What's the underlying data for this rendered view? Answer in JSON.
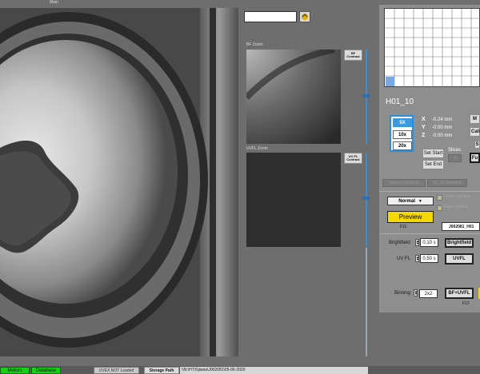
{
  "main_view": {
    "title": "Main"
  },
  "top_input": {
    "value": ""
  },
  "bf_zoom": {
    "title": "BF Zoom",
    "contrast_label": "BF Contrast"
  },
  "uvfl_zoom": {
    "title": "UVFL Zoom",
    "contrast_label": "UV FL Contrast"
  },
  "well_id": "H01_10",
  "objectives": [
    "5X",
    "10x",
    "20x"
  ],
  "selected_objective": "5X",
  "position": {
    "x_label": "X",
    "x_value": "-0.24 mm",
    "y_label": "Y",
    "y_value": "-0.00 mm",
    "z_label": "Z",
    "z_value": "-0.00 mm"
  },
  "buttons": {
    "set_start": "Set Start",
    "set_end": "Set End",
    "slices_label": "Slices",
    "slices_value": "3",
    "select_cell_mode": "Select Cell Mode",
    "all_selected": "A1_00 Selected",
    "right_m": "M",
    "right_cal": "Calib",
    "right_s": "S",
    "right_fu": "Fu"
  },
  "lighting": {
    "mode": "Normal",
    "center": "Center Lighting",
    "edge": "Edge Lighting"
  },
  "preview": {
    "label": "Preview",
    "key": "F11",
    "plate_name": "J002081_H01"
  },
  "exposure": [
    {
      "label": "Brightfield",
      "value": "0.10 s",
      "button": "Brightfield"
    },
    {
      "label": "UV FL",
      "value": "0.50 s",
      "button": "UVFL"
    }
  ],
  "binning": {
    "label": "Binning",
    "value": "2x2",
    "button": "BF+UVFL",
    "key": "F12"
  },
  "status_bar": {
    "motors": "Motors",
    "database": "Database",
    "uvex": "UVEX NOT Loaded",
    "storage_label": "Storage Path",
    "storage_path": "\\\\N:\\HTX\\jiasia\\J002081\\05-06-2020"
  },
  "colors": {
    "accent": "#2a8fd8",
    "preview_yellow": "#f5d800",
    "status_green": "#18d018",
    "background": "#6e6e6e"
  }
}
